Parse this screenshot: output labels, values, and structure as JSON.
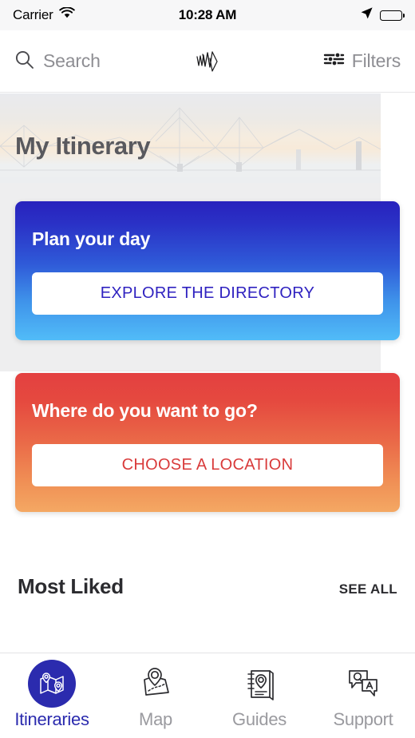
{
  "status_bar": {
    "carrier": "Carrier",
    "time": "10:28 AM",
    "wifi_icon": "wifi-icon",
    "location_icon": "location-arrow-icon",
    "battery_icon": "battery-full-icon"
  },
  "navbar": {
    "search_placeholder": "Search",
    "search_value": "",
    "search_icon": "search-icon",
    "logo_icon": "app-logo-zigzag-icon",
    "filters_label": "Filters",
    "filters_icon": "sliders-icon"
  },
  "hero": {
    "title": "My Itinerary",
    "image_alt": "forth-bridge-sunset-photo"
  },
  "cards": [
    {
      "id": "plan-your-day",
      "heading": "Plan your day",
      "button_label": "EXPLORE THE DIRECTORY",
      "gradient_from": "#2822bd",
      "gradient_to": "#51bcf8",
      "button_text_color": "#2f22c0"
    },
    {
      "id": "where-to-go",
      "heading": "Where do you want to go?",
      "button_label": "CHOOSE A LOCATION",
      "gradient_from": "#e44040",
      "gradient_to": "#f4a863",
      "button_text_color": "#d93b3b"
    }
  ],
  "section": {
    "title": "Most Liked",
    "see_all_label": "SEE ALL"
  },
  "tabbar": {
    "active_index": 0,
    "active_color": "#2b2bae",
    "inactive_color": "#9a9a9f",
    "items": [
      {
        "label": "Itineraries",
        "icon": "map-route-pins-icon"
      },
      {
        "label": "Map",
        "icon": "map-pin-icon"
      },
      {
        "label": "Guides",
        "icon": "notebook-pin-icon"
      },
      {
        "label": "Support",
        "icon": "qa-speech-bubbles-icon"
      }
    ]
  }
}
